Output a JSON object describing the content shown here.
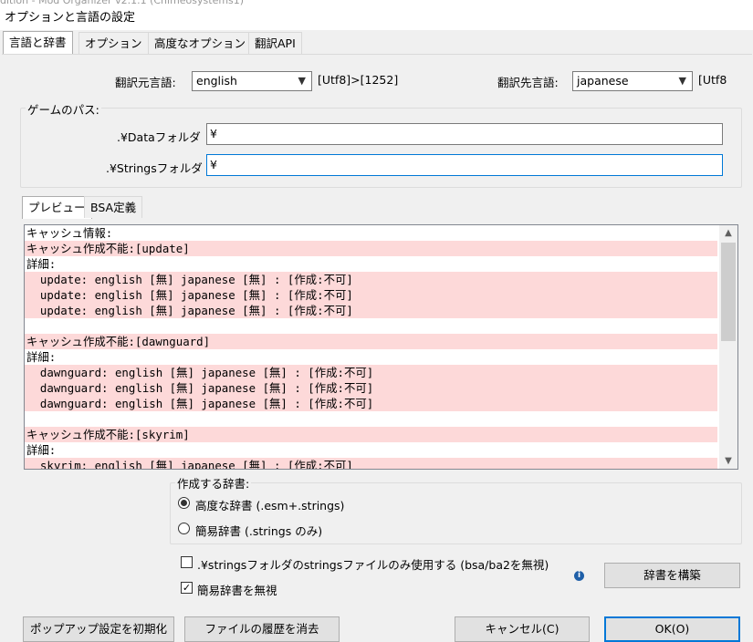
{
  "background_text": "dition - Mod Organizer v2.1.1 (Chimeosystems1)",
  "window": {
    "title": "オプションと言語の設定"
  },
  "tabs": [
    {
      "label": "言語と辞書"
    },
    {
      "label": "オプション"
    },
    {
      "label": "高度なオプション"
    },
    {
      "label": "翻訳API"
    }
  ],
  "language": {
    "source_label": "翻訳元言語:",
    "source_value": "english",
    "source_encoding": "[Utf8]>[1252]",
    "target_label": "翻訳先言語:",
    "target_value": "japanese",
    "target_encoding": "[Utf8"
  },
  "paths": {
    "group_label": "ゲームのパス:",
    "data_label": ".¥Dataフォルダ",
    "data_value": "¥",
    "strings_label": ".¥Stringsフォルダ",
    "strings_value": "¥"
  },
  "preview_tabs": [
    {
      "label": "プレビュー"
    },
    {
      "label": "BSA定義"
    }
  ],
  "preview_lines": [
    {
      "text": "キャッシュ情報:",
      "hl": false
    },
    {
      "text": "キャッシュ作成不能:[update]",
      "hl": true
    },
    {
      "text": "詳細:",
      "hl": false
    },
    {
      "text": "  update: english [無] japanese [無] : [作成:不可]",
      "hl": true
    },
    {
      "text": "  update: english [無] japanese [無] : [作成:不可]",
      "hl": true
    },
    {
      "text": "  update: english [無] japanese [無] : [作成:不可]",
      "hl": true
    },
    {
      "text": "",
      "hl": false
    },
    {
      "text": "キャッシュ作成不能:[dawnguard]",
      "hl": true
    },
    {
      "text": "詳細:",
      "hl": false
    },
    {
      "text": "  dawnguard: english [無] japanese [無] : [作成:不可]",
      "hl": true
    },
    {
      "text": "  dawnguard: english [無] japanese [無] : [作成:不可]",
      "hl": true
    },
    {
      "text": "  dawnguard: english [無] japanese [無] : [作成:不可]",
      "hl": true
    },
    {
      "text": "",
      "hl": false
    },
    {
      "text": "キャッシュ作成不能:[skyrim]",
      "hl": true
    },
    {
      "text": "詳細:",
      "hl": false
    },
    {
      "text": "  skyrim: english [無] japanese [無] : [作成:不可]",
      "hl": true
    }
  ],
  "dictionary": {
    "group_label": "作成する辞書:",
    "option_advanced": "高度な辞書 (.esm+.strings)",
    "option_simple": "簡易辞書 (.strings のみ)",
    "selected": "advanced"
  },
  "options": {
    "strings_only_label": ".¥stringsフォルダのstringsファイルのみ使用する (bsa/ba2を無視)",
    "strings_only_checked": false,
    "ignore_simple_label": "簡易辞書を無視",
    "ignore_simple_checked": true
  },
  "info_icon": "i",
  "buttons": {
    "build": "辞書を構築",
    "reset_popup": "ポップアップ設定を初期化",
    "clear_history": "ファイルの履歴を消去",
    "cancel": "キャンセル(C)",
    "ok": "OK(O)"
  }
}
